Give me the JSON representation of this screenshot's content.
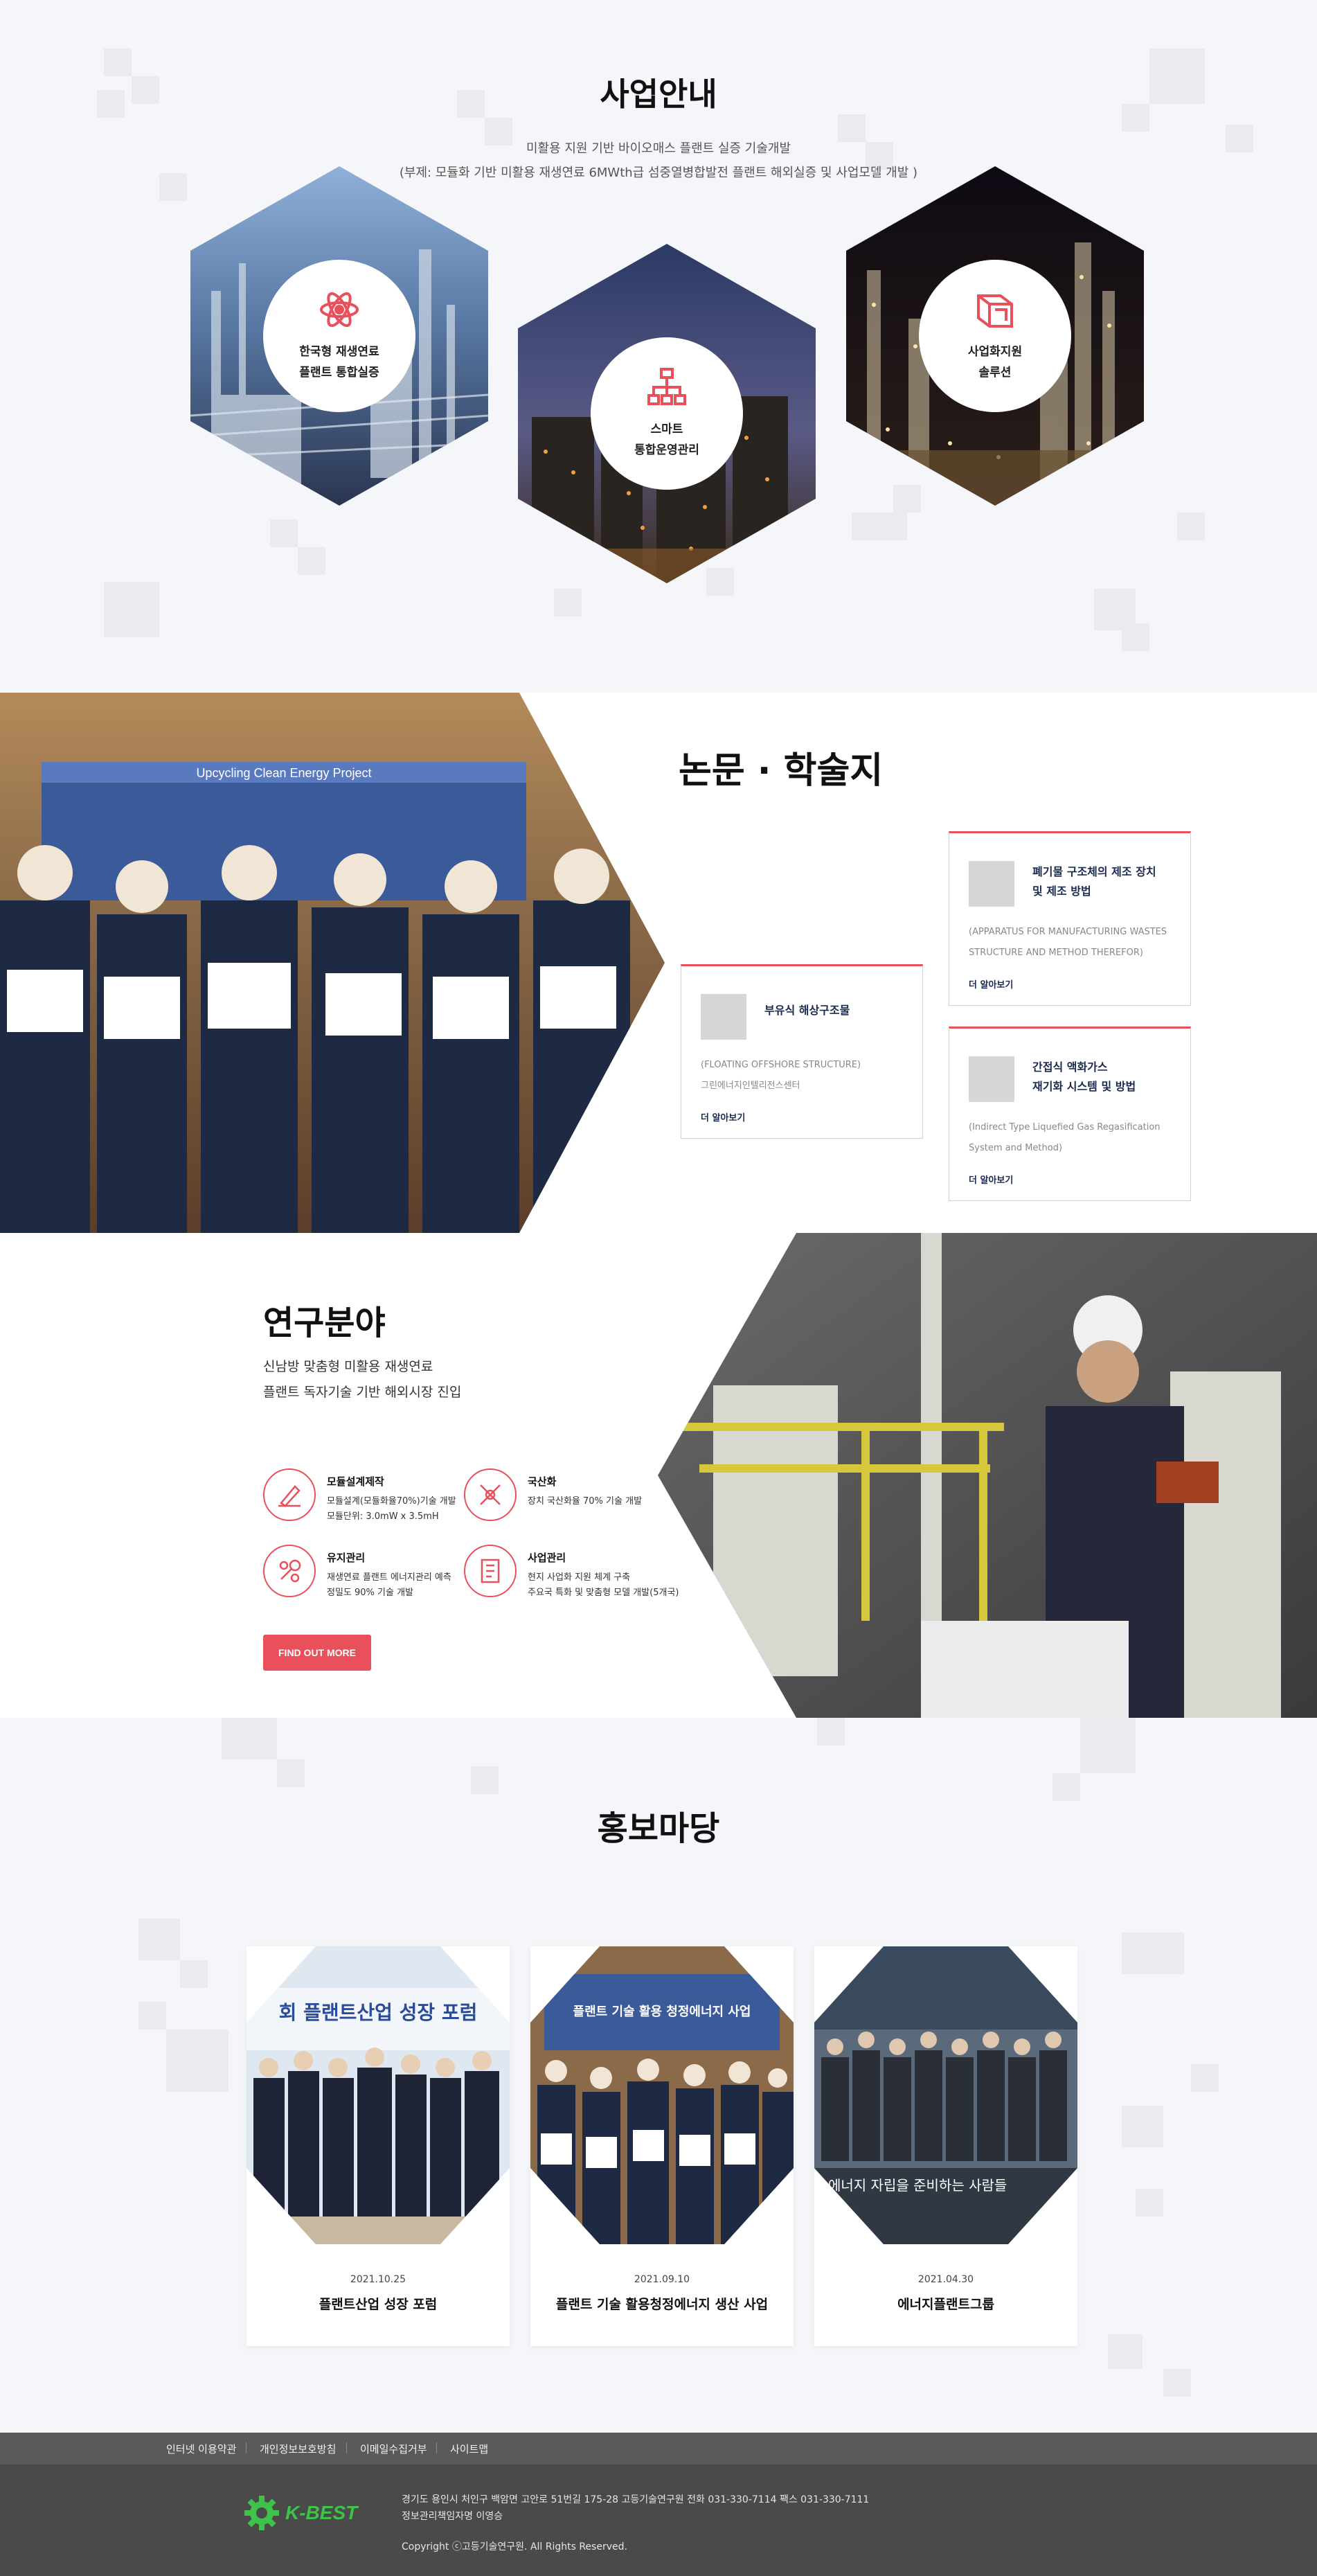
{
  "business": {
    "title": "사업안내",
    "subtitle1": "미활용 지원 기반 바이오매스 플랜트 실증 기술개발",
    "subtitle2": "(부제: 모듈화 기반 미활용 재생연료 6MWth급 섬중열병합발전 플랜트 해외실증 및 사업모델 개발 )",
    "cards": [
      {
        "line1": "한국형 재생연료",
        "line2": "플랜트 통합실증",
        "icon": "atom-icon"
      },
      {
        "line1": "스마트",
        "line2": "통합운영관리",
        "icon": "org-chart-icon"
      },
      {
        "line1": "사업화지원",
        "line2": "솔루션",
        "icon": "cube-icon"
      }
    ]
  },
  "papers": {
    "title": "논문 · 학술지",
    "photo_banner_text": "Upcycling Clean Energy Project",
    "items": [
      {
        "title": "부유식 해상구조물",
        "desc1": "(FLOATING OFFSHORE STRUCTURE)",
        "desc2": "그린에너지인텔리전스센터",
        "more": "더 알아보기"
      },
      {
        "title1": "폐기물 구조체의 제조 장치",
        "title2": "및 제조 방법",
        "desc1": "(APPARATUS FOR MANUFACTURING WASTES",
        "desc2": "STRUCTURE AND METHOD THEREFOR)",
        "more": "더 알아보기"
      },
      {
        "title1": "간접식 액화가스",
        "title2": "재기화 시스템 및 방법",
        "desc1": "(Indirect Type  Liquefied Gas Regasification",
        "desc2": "System and Method)",
        "more": "더 알아보기"
      }
    ]
  },
  "research": {
    "title": "연구분야",
    "desc1": "신남방 맞춤형 미활용 재생연료",
    "desc2": "플랜트 독자기술 기반 해외시장 진입",
    "fields": [
      {
        "name": "모듈설계제작",
        "d1": "모듈설계(모듈화율70%)기술 개발",
        "d2": "모듈단위: 3.0mW x 3.5mH",
        "icon": "pen-icon"
      },
      {
        "name": "국산화",
        "d1": "장치 국산화율 70% 기술 개발",
        "d2": "",
        "icon": "tools-icon"
      },
      {
        "name": "유지관리",
        "d1": "재생연료 플랜트 에너지관리 예측",
        "d2": "정밀도 90% 기술 개발",
        "icon": "wrench-icon"
      },
      {
        "name": "사업관리",
        "d1": "현지 사업화 지원 체계 구축",
        "d2": "주요국 특화 및 맞춤형 모델 개발(5개국)",
        "icon": "document-icon"
      }
    ],
    "button": "FIND OUT MORE"
  },
  "news": {
    "title": "홍보마당",
    "items": [
      {
        "date": "2021.10.25",
        "title": "플랜트산업 성장 포럼",
        "photo_text": "회 플랜트산업 성장 포럼"
      },
      {
        "date": "2021.09.10",
        "title": "플랜트 기술 활용청정에너지 생산 사업",
        "photo_text": "플랜트 기술 활용 청정에너지 사업"
      },
      {
        "date": "2021.04.30",
        "title": "에너지플랜트그룹",
        "photo_text": "에너지 자립을 준비하는 사람들"
      }
    ]
  },
  "footer": {
    "links": [
      "인터넷 이용약관",
      "개인정보보호방침",
      "이메일수집거부",
      "사이트맵"
    ],
    "logo": "K-BEST",
    "address": "경기도 용인시 처인구 백암면 고안로 51번길 175-28 고등기술연구원  전화 031-330-7114  팩스 031-330-7111",
    "manager": "정보관리책임자명 이영승",
    "copyright": "Copyright ⓒ고등기술연구원.  All Rights Reserved."
  },
  "colors": {
    "accent": "#e8505b",
    "navy": "#1b2a4e",
    "footer_dark": "#4a4a4a",
    "logo_green": "#3fc24a"
  }
}
